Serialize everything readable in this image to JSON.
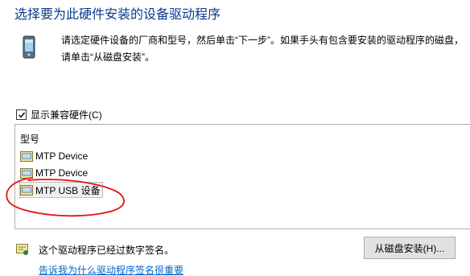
{
  "header": {
    "title": "选择要为此硬件安装的设备驱动程序"
  },
  "instructions": {
    "line1": "请选定硬件设备的厂商和型号，然后单击“下一步”。如果手头有包含要安装的驱动程序的磁盘，",
    "line2": "请单击“从磁盘安装”。"
  },
  "compat": {
    "label": "显示兼容硬件(C)",
    "checked": true
  },
  "model_list": {
    "header": "型号",
    "items": [
      {
        "label": "MTP Device"
      },
      {
        "label": "MTP Device"
      },
      {
        "label": "MTP USB 设备",
        "selected": true
      }
    ]
  },
  "signature": {
    "text": "这个驱动程序已经过数字签名。",
    "link": "告诉我为什么驱动程序签名很重要"
  },
  "buttons": {
    "have_disk": "从磁盘安装(H)..."
  },
  "colors": {
    "title": "#0b3a8c",
    "link": "#0066cc",
    "annotation": "#e31010"
  },
  "icons": {
    "device": "pda-device-icon",
    "driver": "driver-package-icon",
    "signed": "signed-certificate-icon",
    "check": "check-icon"
  }
}
